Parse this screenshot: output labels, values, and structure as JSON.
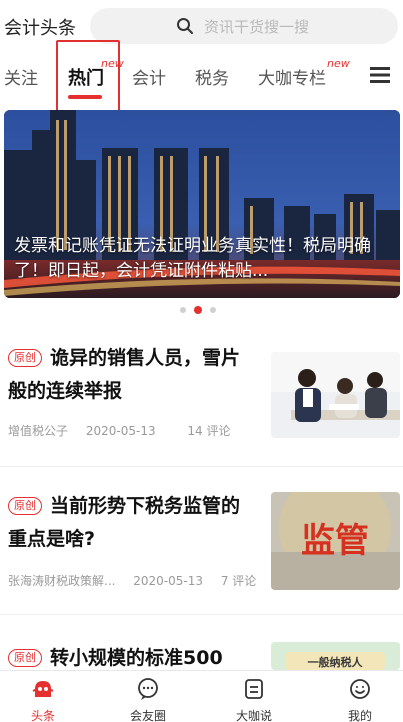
{
  "header": {
    "app_title": "会计头条",
    "search_placeholder": "资讯干货搜一搜"
  },
  "tabs": [
    {
      "label": "关注",
      "active": false,
      "new": false
    },
    {
      "label": "热门",
      "active": true,
      "new": true
    },
    {
      "label": "会计",
      "active": false,
      "new": false
    },
    {
      "label": "税务",
      "active": false,
      "new": false
    },
    {
      "label": "大咖专栏",
      "active": false,
      "new": true
    }
  ],
  "new_badge": "new",
  "banner": {
    "caption": "发票和记账凭证无法证明业务真实性！税局明确了！即日起，会计凭证附件粘贴...",
    "dots_total": 3,
    "dots_active": 1
  },
  "articles": [
    {
      "badge": "原创",
      "title": "诡异的销售人员，雪片般的连续举报",
      "author": "增值税公子",
      "date": "2020-05-13",
      "comments": "14 评论",
      "thumb_text": ""
    },
    {
      "badge": "原创",
      "title": "当前形势下税务监管的重点是啥?",
      "author": "张海涛财税政策解...",
      "date": "2020-05-13",
      "comments": "7 评论",
      "thumb_text": "监管"
    },
    {
      "badge": "原创",
      "title": "转小规模的标准500",
      "author": "",
      "date": "",
      "comments": "",
      "thumb_text": "一般纳税人"
    }
  ],
  "bottom_nav": [
    {
      "label": "头条",
      "icon": "headline-icon",
      "active": true
    },
    {
      "label": "会友圈",
      "icon": "chat-bubble-icon",
      "active": false
    },
    {
      "label": "大咖说",
      "icon": "document-icon",
      "active": false
    },
    {
      "label": "我的",
      "icon": "profile-icon",
      "active": false
    }
  ],
  "colors": {
    "accent": "#e53030",
    "text": "#222222",
    "muted": "#9a9a9a"
  }
}
